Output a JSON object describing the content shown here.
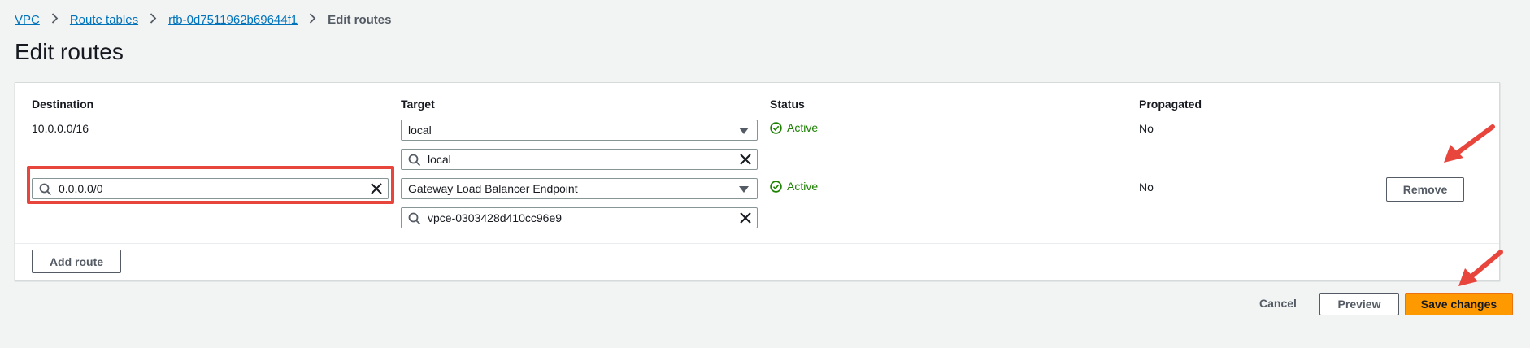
{
  "breadcrumb": {
    "items": [
      "VPC",
      "Route tables",
      "rtb-0d7511962b69644f1"
    ],
    "current": "Edit routes"
  },
  "page": {
    "title": "Edit routes"
  },
  "table": {
    "headers": [
      "Destination",
      "Target",
      "Status",
      "Propagated"
    ],
    "rows": [
      {
        "destination": "10.0.0.0/16",
        "target_type": "local",
        "target_value": "local",
        "status": "Active",
        "propagated": "No"
      },
      {
        "destination": "0.0.0.0/0",
        "target_type": "Gateway Load Balancer Endpoint",
        "target_value": "vpce-0303428d410cc96e9",
        "status": "Active",
        "propagated": "No",
        "remove_label": "Remove"
      }
    ],
    "add_route_label": "Add route"
  },
  "footer": {
    "cancel_label": "Cancel",
    "preview_label": "Preview",
    "save_label": "Save changes"
  },
  "icons": {
    "breadcrumb_separator": "chevron-right-icon",
    "search": "search-icon",
    "clear": "close-icon",
    "caret": "caret-down-icon",
    "status_ok": "check-circle-icon",
    "annotation": "arrow-icon"
  },
  "colors": {
    "link": "#0073bb",
    "success": "#1d8102",
    "primary": "#ff9900",
    "annotation": "#e8453c"
  }
}
